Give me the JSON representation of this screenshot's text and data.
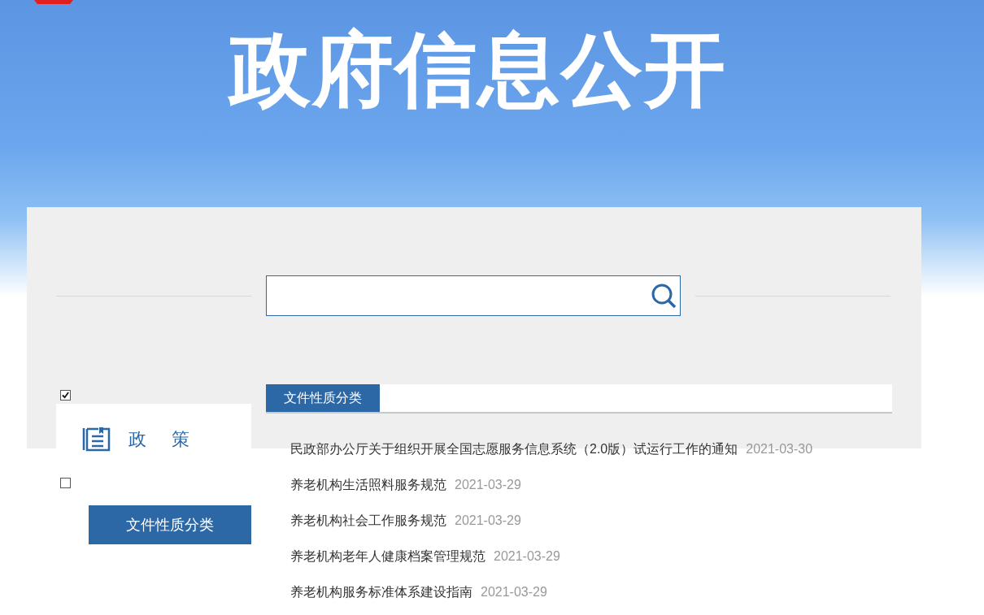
{
  "banner": {
    "title": "政府信息公开"
  },
  "sidebar": {
    "items": [
      {
        "kind": "checkbox",
        "checked": true
      },
      {
        "kind": "card",
        "label": "政策"
      },
      {
        "kind": "checkbox",
        "checked": false
      },
      {
        "kind": "button",
        "label": "文件性质分类",
        "selected": true
      }
    ]
  },
  "tabs": [
    {
      "label": "文件性质分类",
      "selected": true
    }
  ],
  "list": [
    {
      "title": "民政部办公厅关于组织开展全国志愿服务信息系统（2.0版）试运行工作的通知",
      "date": "2021-03-30"
    },
    {
      "title": "养老机构生活照料服务规范",
      "date": "2021-03-29"
    },
    {
      "title": "养老机构社会工作服务规范",
      "date": "2021-03-29"
    },
    {
      "title": "养老机构老年人健康档案管理规范",
      "date": "2021-03-29"
    },
    {
      "title": "养老机构服务标准体系建设指南",
      "date": "2021-03-29"
    }
  ]
}
